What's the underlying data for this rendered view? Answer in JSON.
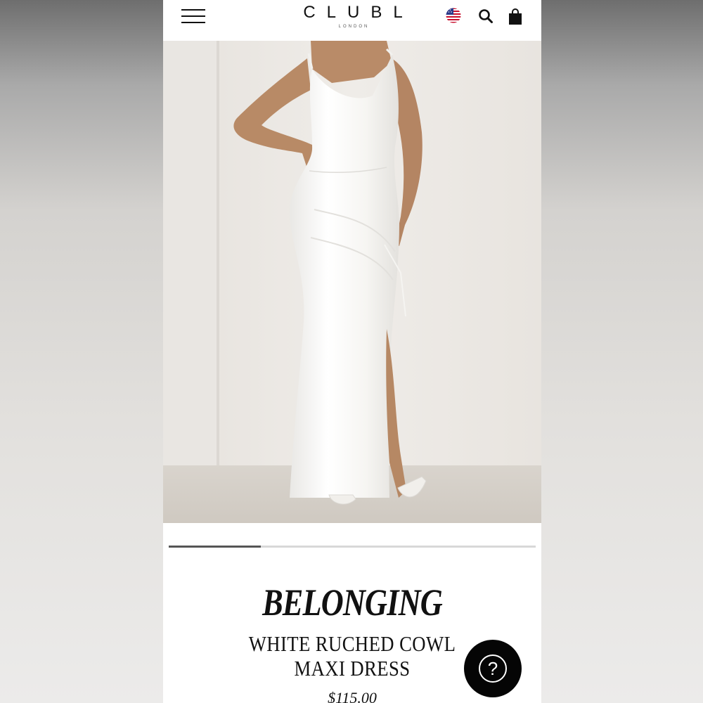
{
  "header": {
    "menu_icon": "hamburger-menu-icon",
    "logo_main": "CLUBL",
    "logo_sub": "LONDON",
    "region_icon": "us-flag-icon",
    "search_icon": "search-icon",
    "bag_icon": "shopping-bag-icon"
  },
  "carousel": {
    "progress": 0.25
  },
  "product": {
    "brand": "BELONGING",
    "name": "WHITE RUCHED COWL MAXI DRESS",
    "price": "$115.00"
  },
  "help": {
    "label": "?",
    "icon": "help-question-icon"
  },
  "colors": {
    "accent": "#111111",
    "dress": "#f7f6f3",
    "backdrop": "#ebe7e2"
  }
}
